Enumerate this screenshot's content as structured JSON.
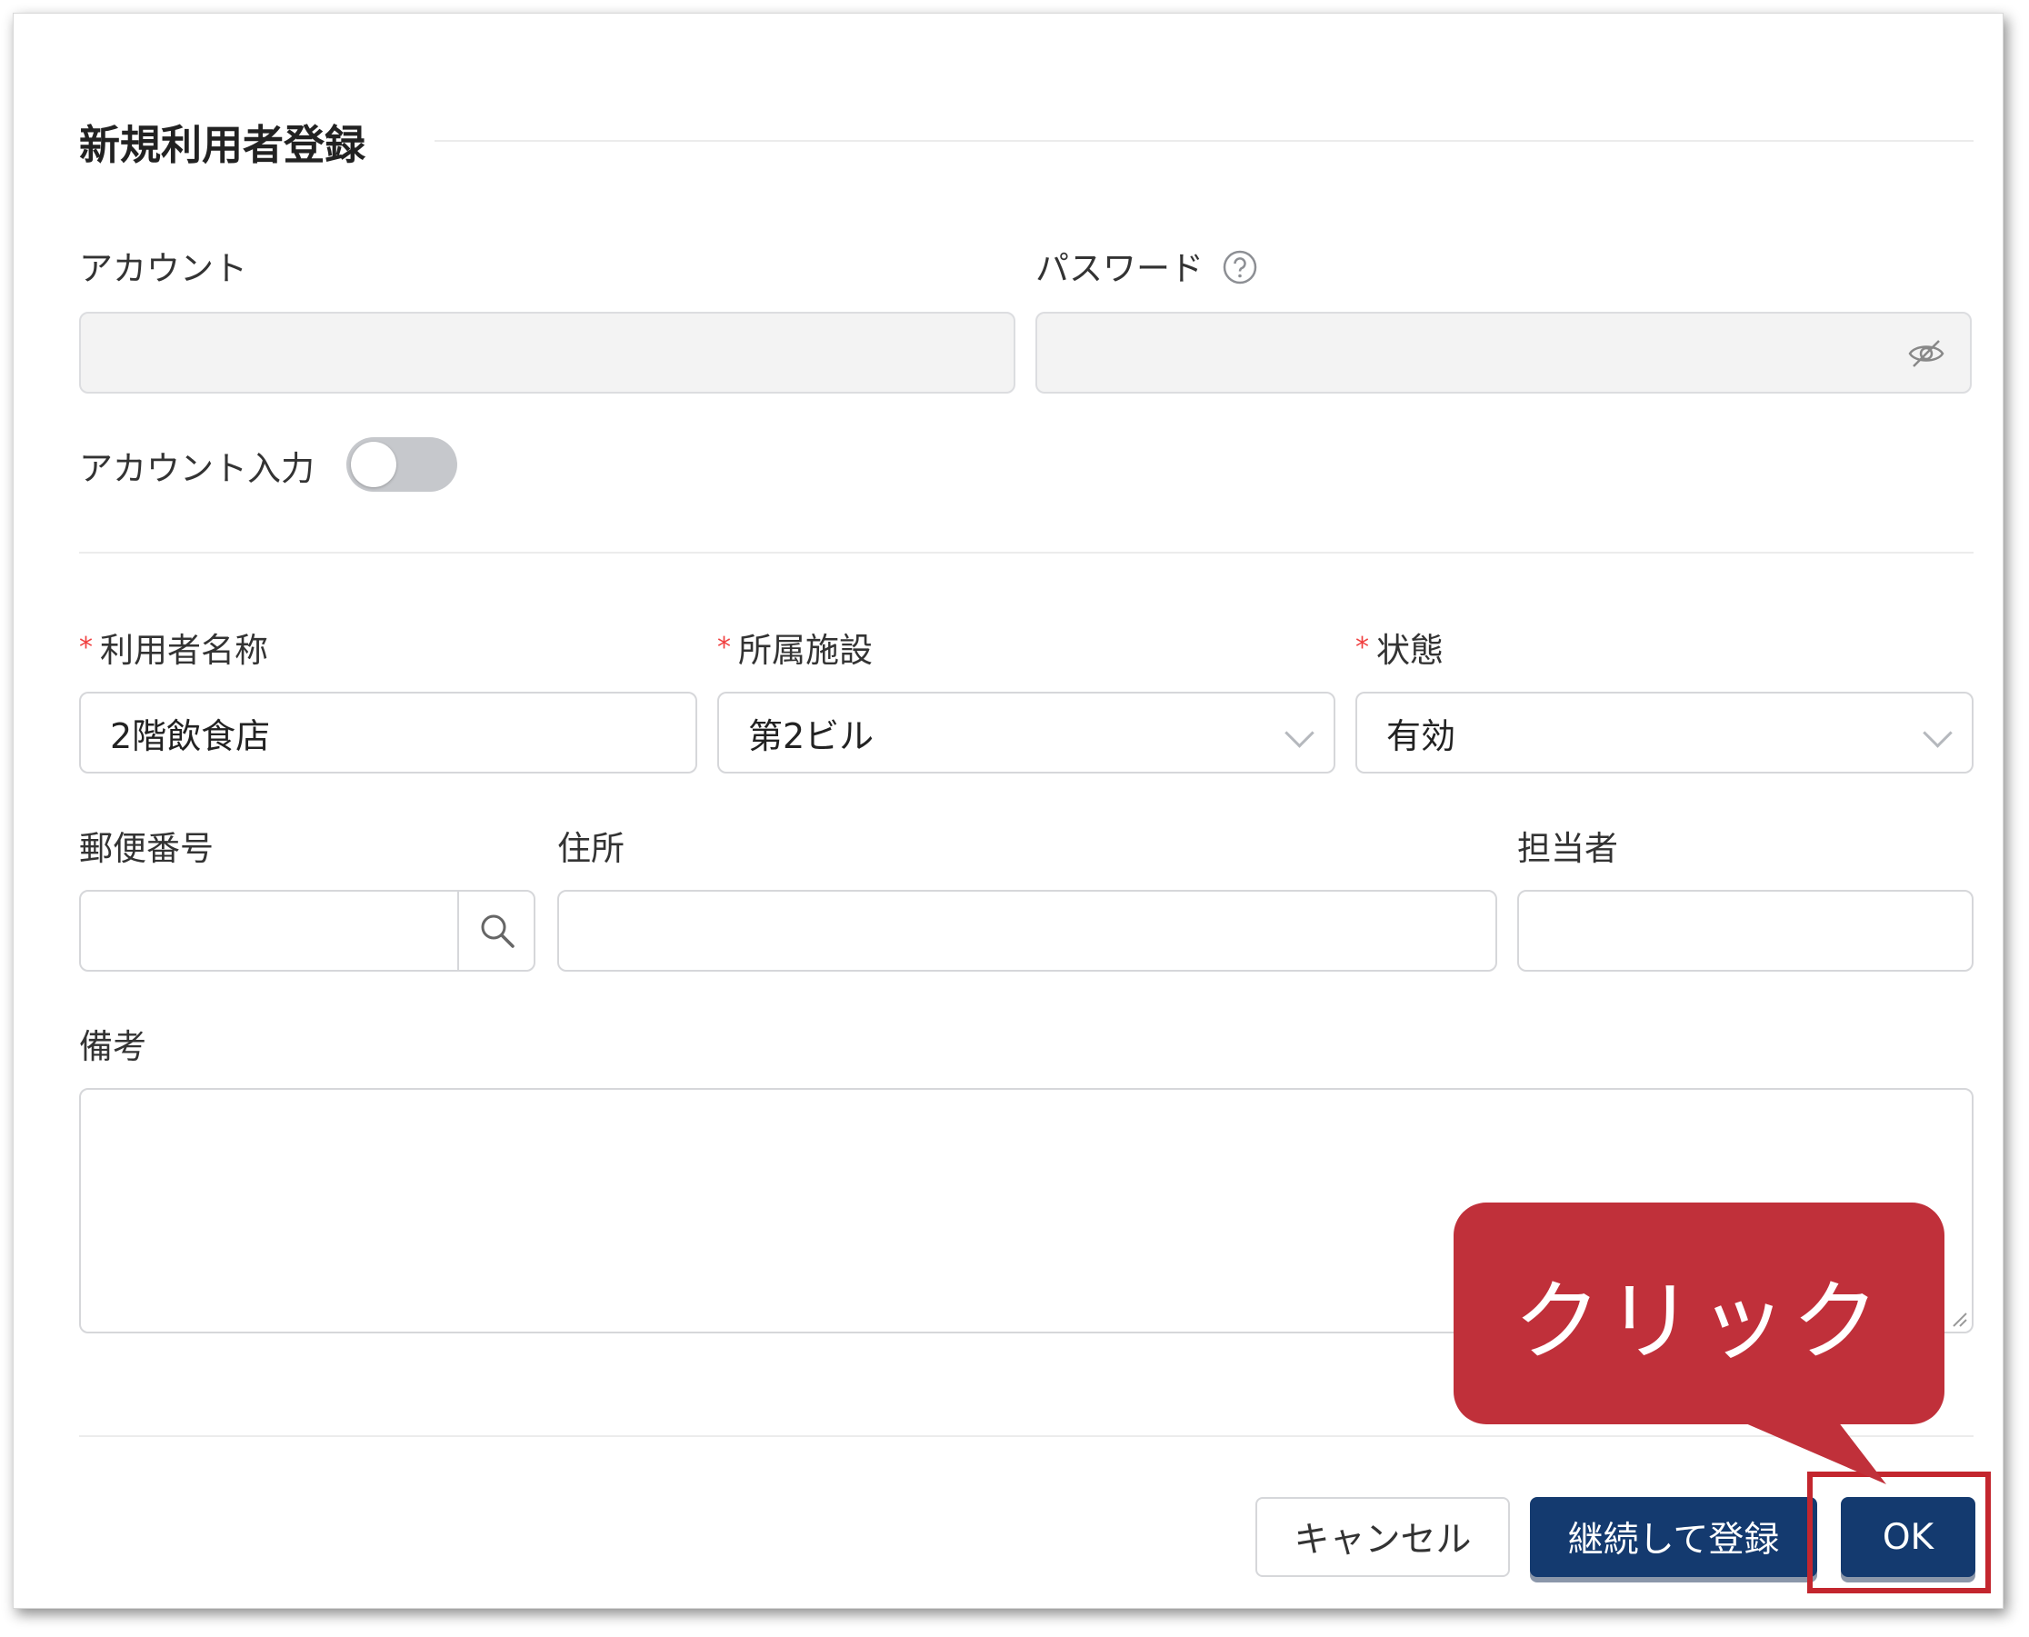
{
  "dialog": {
    "title": "新規利用者登録"
  },
  "account": {
    "label": "アカウント",
    "value": ""
  },
  "password": {
    "label": "パスワード",
    "value": ""
  },
  "account_input_toggle": {
    "label": "アカウント入力",
    "state": "off"
  },
  "user_name": {
    "label": "利用者名称",
    "value": "2階飲食店"
  },
  "facility": {
    "label": "所属施設",
    "value": "第2ビル"
  },
  "status": {
    "label": "状態",
    "value": "有効"
  },
  "postal_code": {
    "label": "郵便番号",
    "value": ""
  },
  "address": {
    "label": "住所",
    "value": ""
  },
  "contact_person": {
    "label": "担当者",
    "value": ""
  },
  "remarks": {
    "label": "備考",
    "value": ""
  },
  "required_mark": "*",
  "buttons": {
    "cancel": "キャンセル",
    "continue_register": "継続して登録",
    "ok": "OK"
  },
  "annotation": {
    "callout_text": "クリック",
    "highlight_color": "#c3262e"
  },
  "colors": {
    "primary": "#143a6f",
    "required": "#f04040",
    "callout": "#c0303a"
  }
}
